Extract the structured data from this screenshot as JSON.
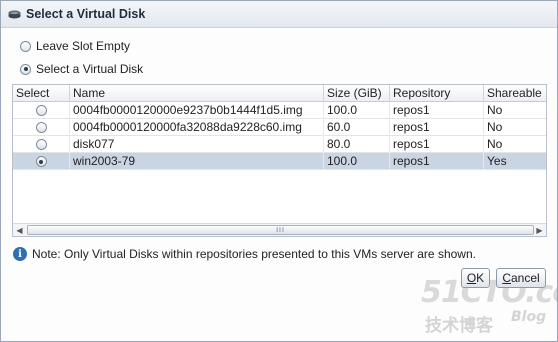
{
  "dialog": {
    "title": "Select a Virtual Disk",
    "icon": "disk-icon"
  },
  "options": [
    {
      "label": "Leave Slot Empty",
      "checked": false
    },
    {
      "label": "Select a Virtual Disk",
      "checked": true
    }
  ],
  "table": {
    "columns": [
      "Select",
      "Name",
      "Size (GiB)",
      "Repository",
      "Shareable"
    ],
    "rows": [
      {
        "selected": false,
        "name": "0004fb0000120000e9237b0b1444f1d5.img",
        "size": "100.0",
        "repository": "repos1",
        "shareable": "No"
      },
      {
        "selected": false,
        "name": "0004fb0000120000fa32088da9228c60.img",
        "size": "60.0",
        "repository": "repos1",
        "shareable": "No"
      },
      {
        "selected": false,
        "name": "disk077",
        "size": "80.0",
        "repository": "repos1",
        "shareable": "No"
      },
      {
        "selected": true,
        "name": "win2003-79",
        "size": "100.0",
        "repository": "repos1",
        "shareable": "Yes"
      }
    ],
    "scroll_left": "◀",
    "scroll_right": "▶",
    "thumb_grip": "III"
  },
  "note": {
    "icon_glyph": "i",
    "text": "Note: Only Virtual Disks within repositories presented to this VMs server are shown."
  },
  "buttons": {
    "ok_mnemonic": "O",
    "ok_rest": "K",
    "cancel_mnemonic": "C",
    "cancel_rest": "ancel"
  },
  "watermark": {
    "line1": "51CTO.com",
    "line2": "技术博客",
    "line3": "Blog"
  },
  "colors": {
    "selected_row": "#c9d5e3",
    "accent": "#2d6fb7"
  }
}
